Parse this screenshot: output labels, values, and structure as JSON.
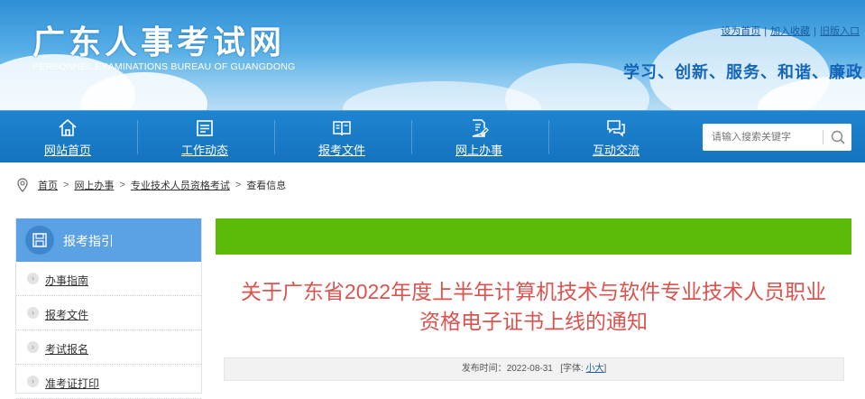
{
  "site": {
    "name_cn": "广东人事考试网",
    "name_en": "PERSONNEL EXAMINATIONS BUREAU OF GUANGDONG",
    "slogan": "学习、创新、服务、和谐、廉政",
    "top_links": [
      "设为首页",
      "加入收藏",
      "旧版入口"
    ],
    "colors": {
      "nav": "#1673be",
      "accent_green": "#5cba08",
      "title_red": "#d9534f",
      "sidebar_head": "#5aa2e3"
    }
  },
  "nav": {
    "items": [
      {
        "label": "网站首页",
        "icon": "home-icon"
      },
      {
        "label": "工作动态",
        "icon": "list-icon"
      },
      {
        "label": "报考文件",
        "icon": "book-icon"
      },
      {
        "label": "网上办事",
        "icon": "edit-icon"
      },
      {
        "label": "互动交流",
        "icon": "chat-icon"
      }
    ],
    "search_placeholder": "请输入搜索关键字"
  },
  "breadcrumb": {
    "items": [
      "首页",
      "网上办事",
      "专业技术人员资格考试",
      "查看信息"
    ]
  },
  "sidebar": {
    "title": "报考指引",
    "items": [
      "办事指南",
      "报考文件",
      "考试报名",
      "准考证打印"
    ]
  },
  "article": {
    "title_line1": "关于广东省2022年度上半年计算机技术与软件专业技术人员职业",
    "title_line2": "资格电子证书上线的通知",
    "publish_label": "发布时间：",
    "publish_date": "2022-08-31",
    "font_label": "[字体:",
    "font_small": "小",
    "font_large": "大",
    "font_close": "]"
  }
}
